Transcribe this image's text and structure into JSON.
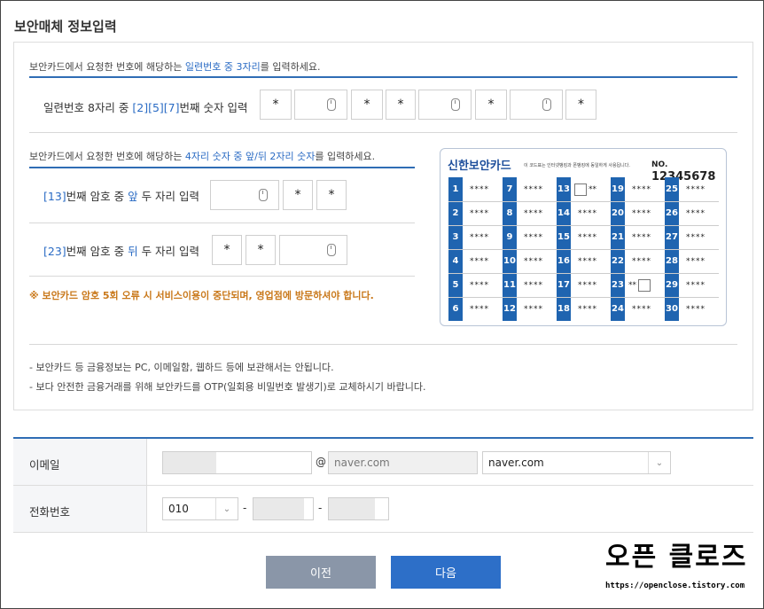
{
  "title": "보안매체 정보입력",
  "section1": {
    "instruction_pre": "보안카드에서 요청한 번호에 해당하는 ",
    "instruction_highlight": "일련번호 중 3자리",
    "instruction_post": "를 입력하세요.",
    "label_pre": "일련번호 8자리 중 ",
    "label_highlight": "[2][5][7]",
    "label_post": "번째 숫자 입력",
    "mask": "*"
  },
  "section2": {
    "instruction_pre": "보안카드에서 요청한 번호에 해당하는 ",
    "instruction_highlight": "4자리 숫자 중 앞/뒤 2자리 숫자",
    "instruction_post": "를 입력하세요.",
    "row1_num": "[13]",
    "row1_mid": "번째 암호 중 ",
    "row1_hl": "앞",
    "row1_post": " 두 자리 입력",
    "row2_num": "[23]",
    "row2_mid": "번째 암호 중 ",
    "row2_hl": "뒤",
    "row2_post": " 두 자리 입력",
    "warning": "※ 보안카드 암호 5회 오류 시 서비스이용이 중단되며, 영업점에 방문하셔야 합니다."
  },
  "card": {
    "brand": "신한보안카드",
    "notice": "이 코드표는 인터넷뱅킹과 폰뱅킹에 동일하게 사용됩니다.",
    "no_label": "NO.",
    "no_value": "12345678",
    "stars": "****",
    "half": "**",
    "numbers": [
      "1",
      "2",
      "3",
      "4",
      "5",
      "6",
      "7",
      "8",
      "9",
      "10",
      "11",
      "12",
      "13",
      "14",
      "15",
      "16",
      "17",
      "18",
      "19",
      "20",
      "21",
      "22",
      "23",
      "24",
      "25",
      "26",
      "27",
      "28",
      "29",
      "30"
    ]
  },
  "notes": [
    "- 보안카드 등 금융정보는 PC, 이메일함, 웹하드 등에 보관해서는 안됩니다.",
    "- 보다 안전한 금융거래를 위해 보안카드를 OTP(일회용 비밀번호 발생기)로 교체하시기 바랍니다."
  ],
  "form": {
    "email_label": "이메일",
    "at": "@",
    "domain_value": "naver.com",
    "domain_select": "naver.com",
    "phone_label": "전화번호",
    "phone_prefix": "010",
    "dash": "-"
  },
  "buttons": {
    "prev": "이전",
    "next": "다음"
  },
  "watermark": {
    "text": "오픈 클로즈",
    "url": "https://openclose.tistory.com"
  },
  "colors": {
    "accent": "#2f6db5",
    "prev_btn": "#8a96a8",
    "next_btn": "#2d6fc8",
    "warning": "#c9781a"
  }
}
